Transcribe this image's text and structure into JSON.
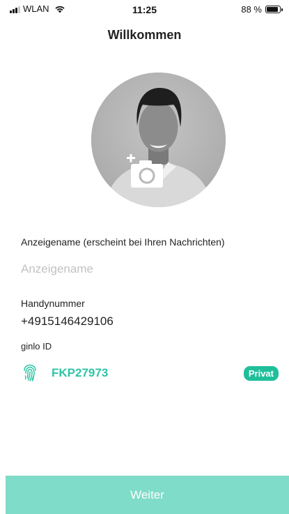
{
  "status_bar": {
    "carrier": "WLAN",
    "time": "11:25",
    "battery": "88 %",
    "battery_level": 0.88
  },
  "header": {
    "title": "Willkommen"
  },
  "form": {
    "display_name_label": "Anzeigename (erscheint bei Ihren Nachrichten)",
    "display_name_placeholder": "Anzeigename",
    "display_name_value": "",
    "phone_label": "Handynummer",
    "phone_value": "+4915146429106",
    "ginlo_id_label": "ginlo ID",
    "ginlo_id_value": "FKP27973",
    "privacy_badge": "Privat"
  },
  "footer": {
    "continue_label": "Weiter"
  },
  "colors": {
    "accent": "#2ec4a6",
    "badge": "#1fbf9a",
    "button": "#7edcc8",
    "avatar_bg": "#b8b8b8"
  },
  "icons": [
    "signal-icon",
    "wifi-icon",
    "battery-icon",
    "avatar-placeholder-icon",
    "camera-add-icon",
    "fingerprint-icon"
  ]
}
